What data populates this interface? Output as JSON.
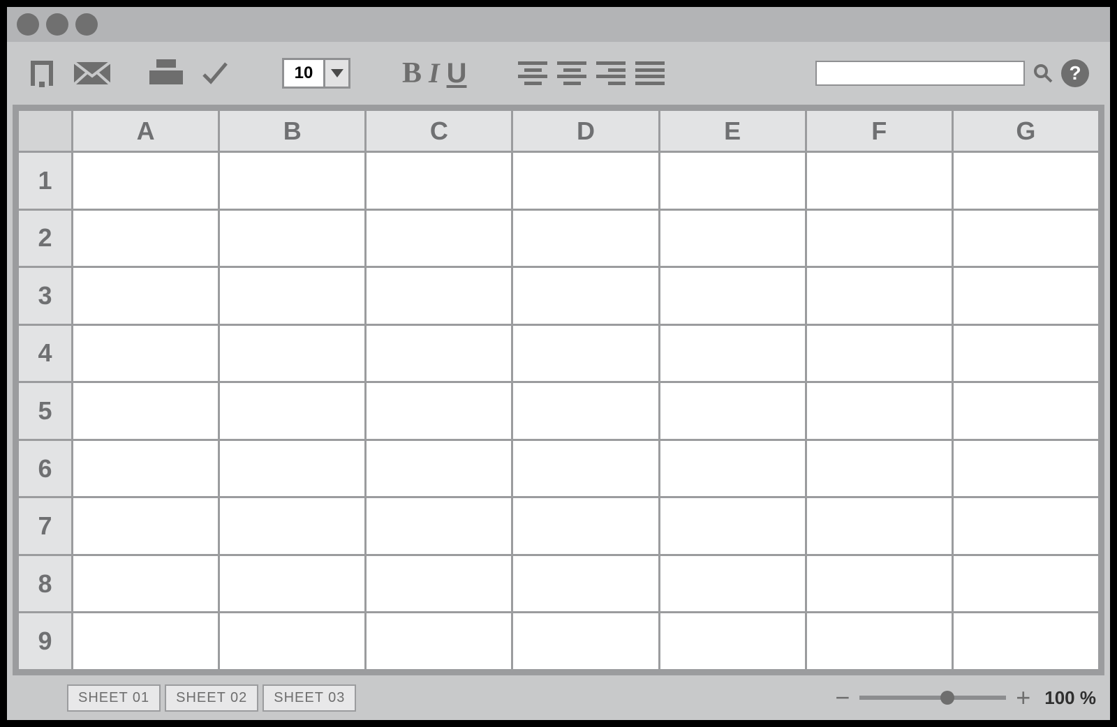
{
  "toolbar": {
    "font_size": "10",
    "bold_label": "B",
    "italic_label": "I",
    "underline_label": "U",
    "help_label": "?",
    "search_value": ""
  },
  "columns": [
    "A",
    "B",
    "C",
    "D",
    "E",
    "F",
    "G"
  ],
  "rows": [
    "1",
    "2",
    "3",
    "4",
    "5",
    "6",
    "7",
    "8",
    "9"
  ],
  "cells": {},
  "sheets": [
    "SHEET 01",
    "SHEET 02",
    "SHEET 03"
  ],
  "status": {
    "zoom_label": "100 %",
    "zoom_minus": "−",
    "zoom_plus": "+"
  }
}
